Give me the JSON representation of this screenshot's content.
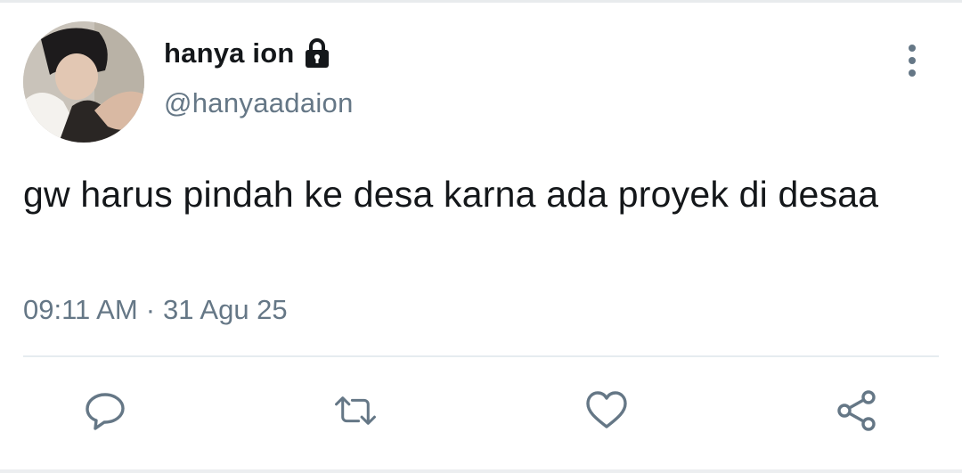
{
  "tweet": {
    "display_name": "hanya ion",
    "handle": "@hanyaadaion",
    "text": "gw harus pindah ke desa karna ada proyek di desaa",
    "time": "09:11 AM",
    "separator": "·",
    "date": "31 Agu 25"
  },
  "icons": {
    "protected": "lock-icon",
    "menu": "more-vertical-icon",
    "reply": "reply-icon",
    "retweet": "retweet-icon",
    "like": "heart-icon",
    "share": "share-icon"
  },
  "colors": {
    "text_primary": "#14171a",
    "text_secondary": "#657786",
    "divider": "#e6ecf0",
    "background": "#ffffff"
  }
}
